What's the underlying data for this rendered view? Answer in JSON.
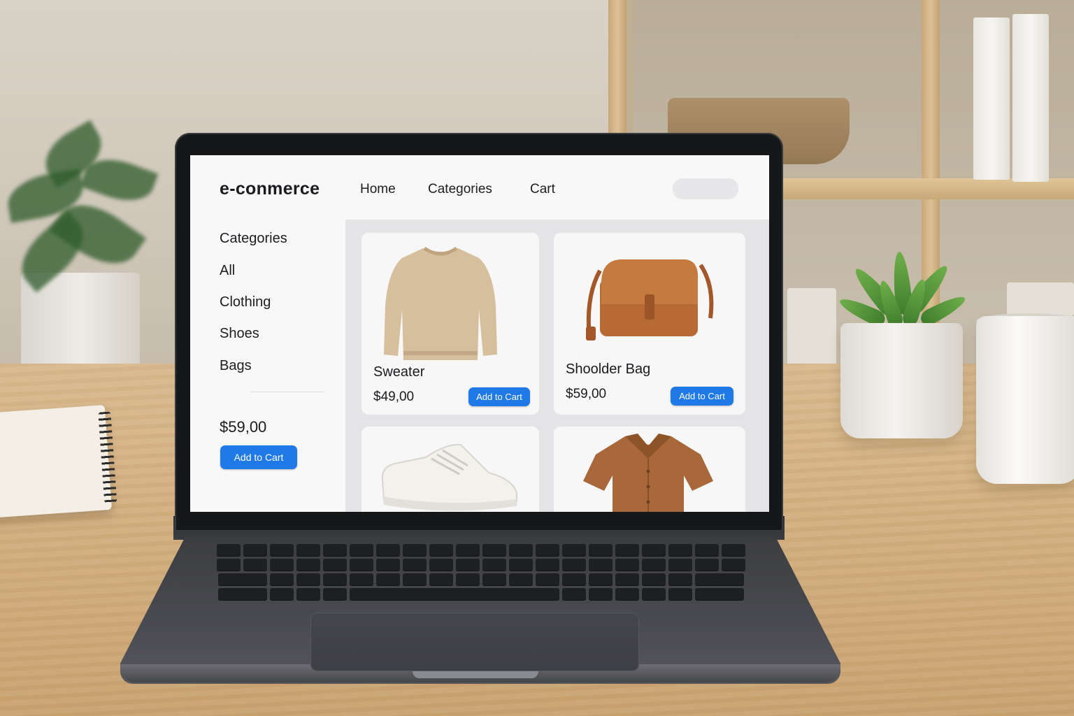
{
  "header": {
    "brand": "e-conmerce",
    "nav": [
      "Home",
      "Categories",
      "Cart"
    ]
  },
  "sidebar": {
    "heading": "Categories",
    "items": [
      "All",
      "Clothing",
      "Shoes",
      "Bags"
    ],
    "price": "$59,00",
    "button_label": "Add to Cart"
  },
  "products": [
    {
      "name": "Sweater",
      "price": "$49,00",
      "button_label": "Add to Cart",
      "image": "sweater-image"
    },
    {
      "name": "Shoolder Bag",
      "price": "$59,00",
      "button_label": "Add to Cart",
      "image": "shoulder-bag-image"
    },
    {
      "name": "",
      "price": "",
      "button_label": "",
      "image": "sneaker-image"
    },
    {
      "name": "",
      "price": "",
      "button_label": "",
      "image": "shirt-image"
    }
  ],
  "colors": {
    "accent": "#1f7ae8",
    "background": "#f6f6f7",
    "grid_background": "#e4e4e7",
    "text": "#1b1b1f"
  }
}
